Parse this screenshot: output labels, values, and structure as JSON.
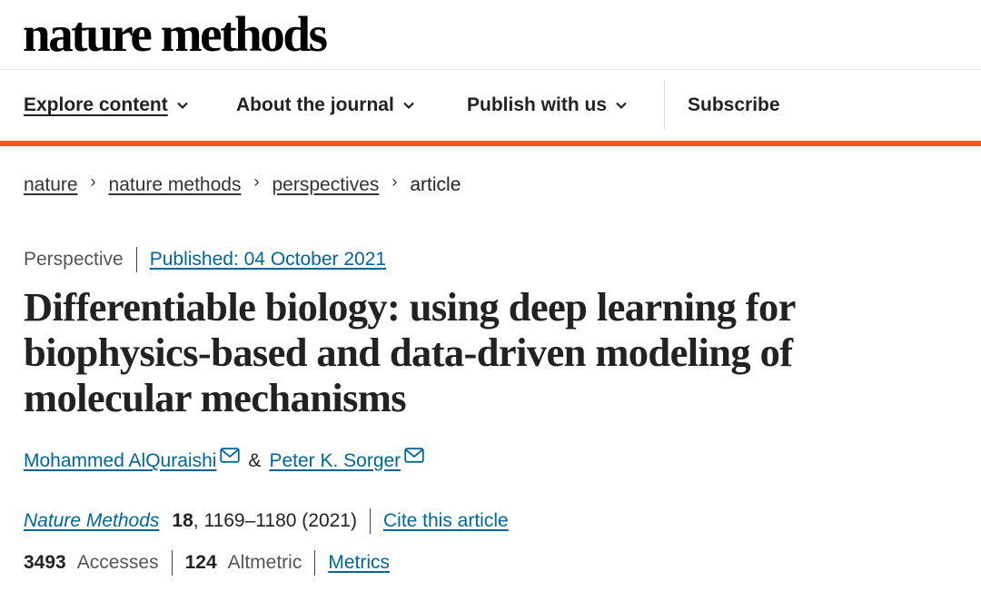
{
  "site": {
    "logo": "nature methods"
  },
  "nav": {
    "items": [
      {
        "label": "Explore content",
        "has_dropdown": true
      },
      {
        "label": "About the journal",
        "has_dropdown": true
      },
      {
        "label": "Publish with us",
        "has_dropdown": true
      },
      {
        "label": "Subscribe",
        "has_dropdown": false
      }
    ]
  },
  "breadcrumb": {
    "items": [
      "nature",
      "nature methods",
      "perspectives"
    ],
    "current": "article"
  },
  "article": {
    "type": "Perspective",
    "published": "Published: 04 October 2021",
    "title": "Differentiable biology: using deep learning for biophysics-based and data-driven modeling of molecular mechanisms",
    "authors": [
      "Mohammed AlQuraishi",
      "Peter K. Sorger"
    ],
    "author_separator": "&",
    "citation": {
      "journal": "Nature Methods",
      "volume": "18",
      "pages": ", 1169–1180 (2021)",
      "cite_label": "Cite this article"
    },
    "metrics": {
      "accesses_count": "3493",
      "accesses_label": "Accesses",
      "altmetric_count": "124",
      "altmetric_label": "Altmetric",
      "metrics_link": "Metrics"
    }
  },
  "colors": {
    "accent": "#ea5c28",
    "link": "#006699",
    "text": "#222222"
  },
  "icons": {
    "dropdown": "chevron-down-icon",
    "email": "mail-icon",
    "breadcrumb_sep": "chevron-right-icon"
  }
}
